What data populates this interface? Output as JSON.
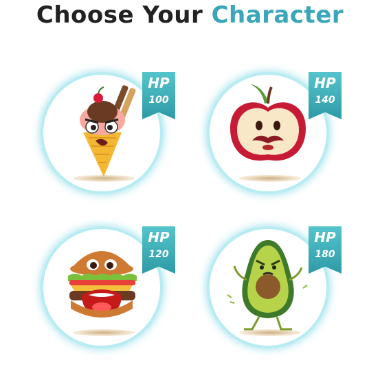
{
  "title": {
    "part1": "Choose Your ",
    "part2": "Character"
  },
  "colors": {
    "accent": "#3aa6b9",
    "badge_top": "#55c4cc",
    "badge_bottom": "#2e9aa6"
  },
  "characters": [
    {
      "name_icon": "ice-cream-cone-icon",
      "hp_label": "HP",
      "hp": "100"
    },
    {
      "name_icon": "apple-icon",
      "hp_label": "HP",
      "hp": "140"
    },
    {
      "name_icon": "burger-icon",
      "hp_label": "HP",
      "hp": "120"
    },
    {
      "name_icon": "avocado-icon",
      "hp_label": "HP",
      "hp": "180"
    }
  ]
}
